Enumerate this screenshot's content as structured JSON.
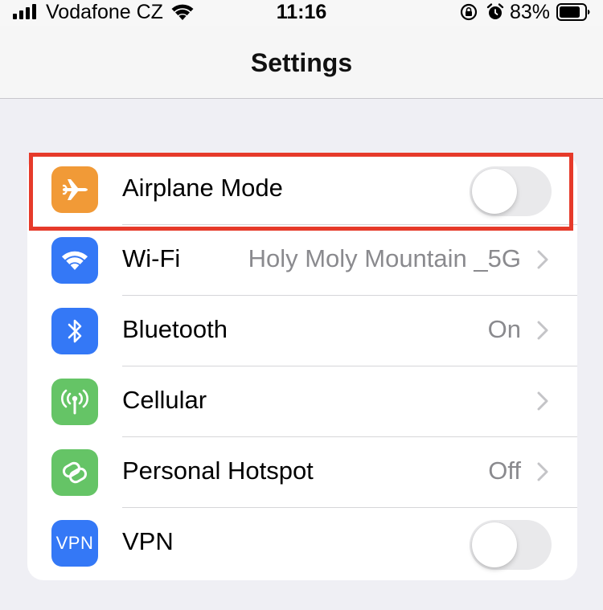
{
  "status_bar": {
    "carrier": "Vodafone CZ",
    "time": "11:16",
    "battery_percent": "83%",
    "battery_level": 0.83,
    "icons": [
      "signal-icon",
      "wifi-icon",
      "orientation-lock-icon",
      "alarm-icon",
      "battery-icon"
    ]
  },
  "nav": {
    "title": "Settings"
  },
  "settings": {
    "items": [
      {
        "label": "Airplane Mode",
        "icon": "airplane-icon",
        "icon_color": "#f19a37",
        "control": "toggle",
        "toggle_on": false
      },
      {
        "label": "Wi-Fi",
        "value": "Holy Moly Mountain _5G",
        "icon": "wifi-icon",
        "icon_color": "#3478f6",
        "control": "chevron"
      },
      {
        "label": "Bluetooth",
        "value": "On",
        "icon": "bluetooth-icon",
        "icon_color": "#3478f6",
        "control": "chevron"
      },
      {
        "label": "Cellular",
        "icon": "antenna-icon",
        "icon_color": "#65c466",
        "control": "chevron"
      },
      {
        "label": "Personal Hotspot",
        "value": "Off",
        "icon": "hotspot-icon",
        "icon_color": "#65c466",
        "control": "chevron"
      },
      {
        "label": "VPN",
        "icon_text": "VPN",
        "icon": "vpn-icon",
        "icon_color": "#3478f6",
        "control": "toggle",
        "toggle_on": false
      }
    ]
  },
  "highlight_color": "#e63a2a"
}
